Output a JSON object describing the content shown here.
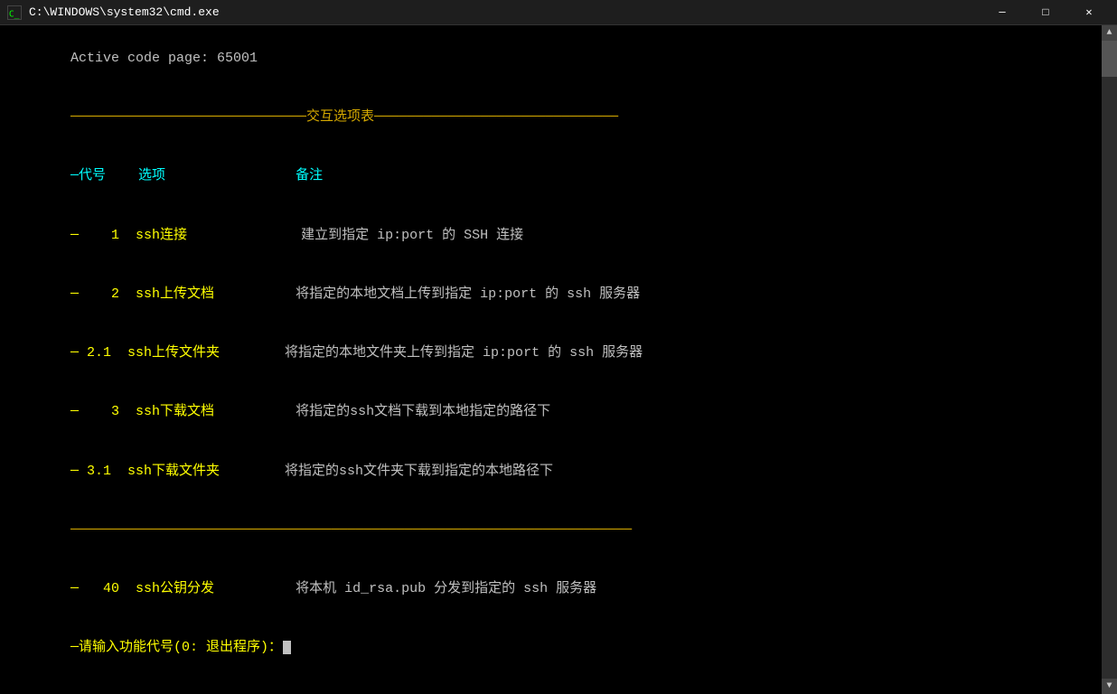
{
  "titlebar": {
    "icon_label": "cmd-icon",
    "title": "C:\\WINDOWS\\system32\\cmd.exe",
    "minimize_label": "─",
    "maximize_label": "□",
    "close_label": "✕"
  },
  "terminal": {
    "line_codepage": "Active code page: 65001",
    "divider_top": "─────────────────────────────交互选项表──────────────────────────────",
    "header_dash": "─代号",
    "header_option": "选项",
    "header_note": "备注",
    "rows": [
      {
        "dash": "─    1",
        "option": "ssh连接          ",
        "note": "建立到指定 ip:port 的 SSH 连接"
      },
      {
        "dash": "─    2",
        "option": "ssh上传文档      ",
        "note": "将指定的本地文档上传到指定 ip:port 的 ssh 服务器"
      },
      {
        "dash": "─ 2.1",
        "option": "ssh上传文件夹    ",
        "note": "将指定的本地文件夹上传到指定 ip:port 的 ssh 服务器"
      },
      {
        "dash": "─    3",
        "option": "ssh下载文档      ",
        "note": "将指定的ssh文档下载到本地指定的路径下"
      },
      {
        "dash": "─ 3.1",
        "option": "ssh下载文件夹    ",
        "note": "将指定的ssh文件夹下载到指定的本地路径下"
      }
    ],
    "divider_mid": "─────────────────────────────────────────────────────────────────────",
    "row_40_dash": "─   40",
    "row_40_option": "ssh公钥分发      ",
    "row_40_note": "将本机 id_rsa.pub 分发到指定的 ssh 服务器",
    "prompt": "─请输入功能代号(0: 退出程序)："
  }
}
